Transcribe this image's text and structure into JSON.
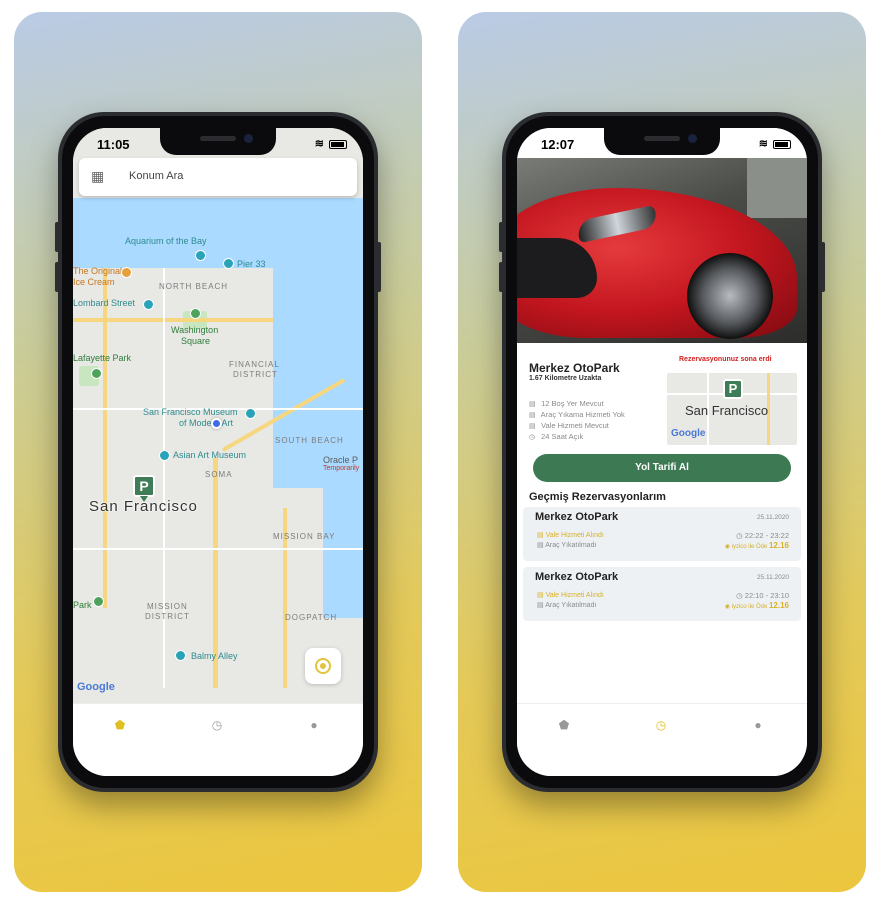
{
  "left_screen": {
    "status_time": "11:05",
    "search_placeholder": "Konum Ara",
    "map": {
      "city": "San Francisco",
      "labels": {
        "aquarium": "Aquarium of the Bay",
        "pier33": "Pier 33",
        "original": "The Original",
        "icecream": "Ice Cream",
        "lombard": "Lombard Street",
        "northbeach": "NORTH BEACH",
        "washington": "Washington",
        "square": "Square",
        "lafayette": "Lafayette Park",
        "financial": "FINANCIAL",
        "district": "DISTRICT",
        "sfmuseum": "San Francisco Museum",
        "modernart": "of Modern Art",
        "southbeach": "SOUTH BEACH",
        "asianart": "Asian Art Museum",
        "oracle": "Oracle P",
        "temporarily": "Temporarily",
        "soma": "SOMA",
        "missionbay": "MISSION BAY",
        "mission": "MISSION",
        "missiondistrict": "DISTRICT",
        "dogpatch": "DOGPATCH",
        "park": "Park",
        "balmy": "Balmy Alley",
        "google": "Google"
      }
    }
  },
  "right_screen": {
    "status_time": "12:07",
    "parking": {
      "name": "Merkez OtoPark",
      "distance": "1.67 Kilometre Uzakta",
      "status": "Rezervasyonunuz sona erdi",
      "features": [
        "12 Boş Yer Mevcut",
        "Araç Yıkama Hizmeti Yok",
        "Vale Hizmeti Mevcut",
        "24 Saat Açık"
      ],
      "minimap_city": "San Francisco",
      "minimap_google": "Google"
    },
    "route_button": "Yol Tarifi Al",
    "history_title": "Geçmiş Rezervasyonlarım",
    "history": [
      {
        "name": "Merkez OtoPark",
        "date": "25.11.2020",
        "valet": "Vale Hizmeti Alındı",
        "wash": "Araç Yıkatılmadı",
        "time": "22:22 - 23:22",
        "pay_label": "iyzico ile Öde",
        "amount": "12.16"
      },
      {
        "name": "Merkez OtoPark",
        "date": "25.11.2020",
        "valet": "Vale Hizmeti Alındı",
        "wash": "Araç Yıkatılmadı",
        "time": "22:10 - 23:10",
        "pay_label": "iyzico ile Öde",
        "amount": "12.16"
      }
    ]
  },
  "icons": [
    "map-search-icon",
    "location-pin-icon",
    "clock-icon",
    "user-icon",
    "locate-icon",
    "wifi-icon",
    "battery-icon"
  ],
  "colors": {
    "accent_green": "#3d7a53",
    "accent_yellow": "#e0c020",
    "expired_red": "#d42020"
  }
}
